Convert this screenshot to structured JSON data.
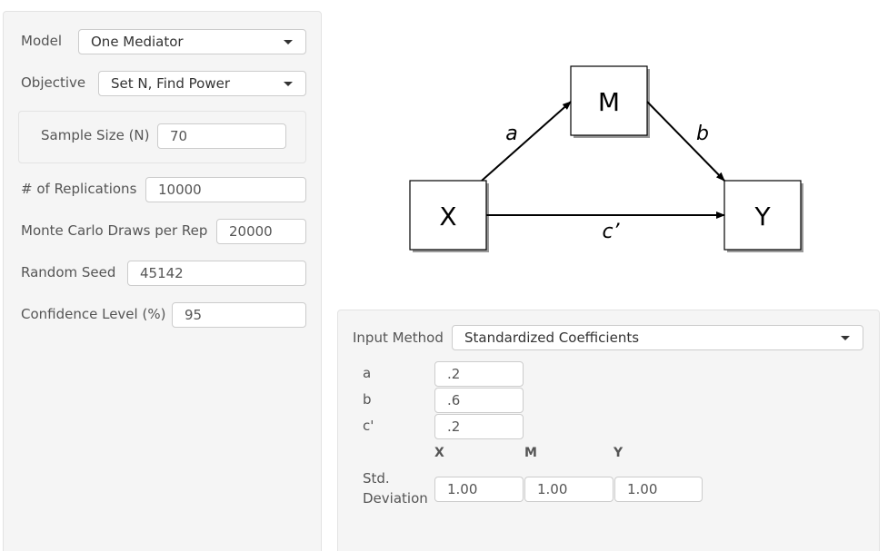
{
  "left_panel": {
    "model": {
      "label": "Model",
      "value": "One Mediator"
    },
    "objective": {
      "label": "Objective",
      "value": "Set N, Find Power"
    },
    "sample_size": {
      "label": "Sample Size (N)",
      "value": "70"
    },
    "replications": {
      "label": "# of Replications",
      "value": "10000"
    },
    "mc_draws": {
      "label": "Monte Carlo Draws per Rep",
      "value": "20000"
    },
    "seed": {
      "label": "Random Seed",
      "value": "45142"
    },
    "confidence": {
      "label": "Confidence Level (%)",
      "value": "95"
    }
  },
  "diagram": {
    "nodes": {
      "x": "X",
      "m": "M",
      "y": "Y"
    },
    "paths": {
      "a": "a",
      "b": "b",
      "c_prime": "c’"
    }
  },
  "right_panel": {
    "input_method": {
      "label": "Input Method",
      "value": "Standardized Coefficients"
    },
    "coefficients": [
      {
        "label": "a",
        "value": ".2"
      },
      {
        "label": "b",
        "value": ".6"
      },
      {
        "label": "c'",
        "value": ".2"
      }
    ],
    "columns": [
      "X",
      "M",
      "Y"
    ],
    "std_dev": {
      "label_line1": "Std.",
      "label_line2": "Deviation",
      "values": [
        "1.00",
        "1.00",
        "1.00"
      ]
    }
  }
}
